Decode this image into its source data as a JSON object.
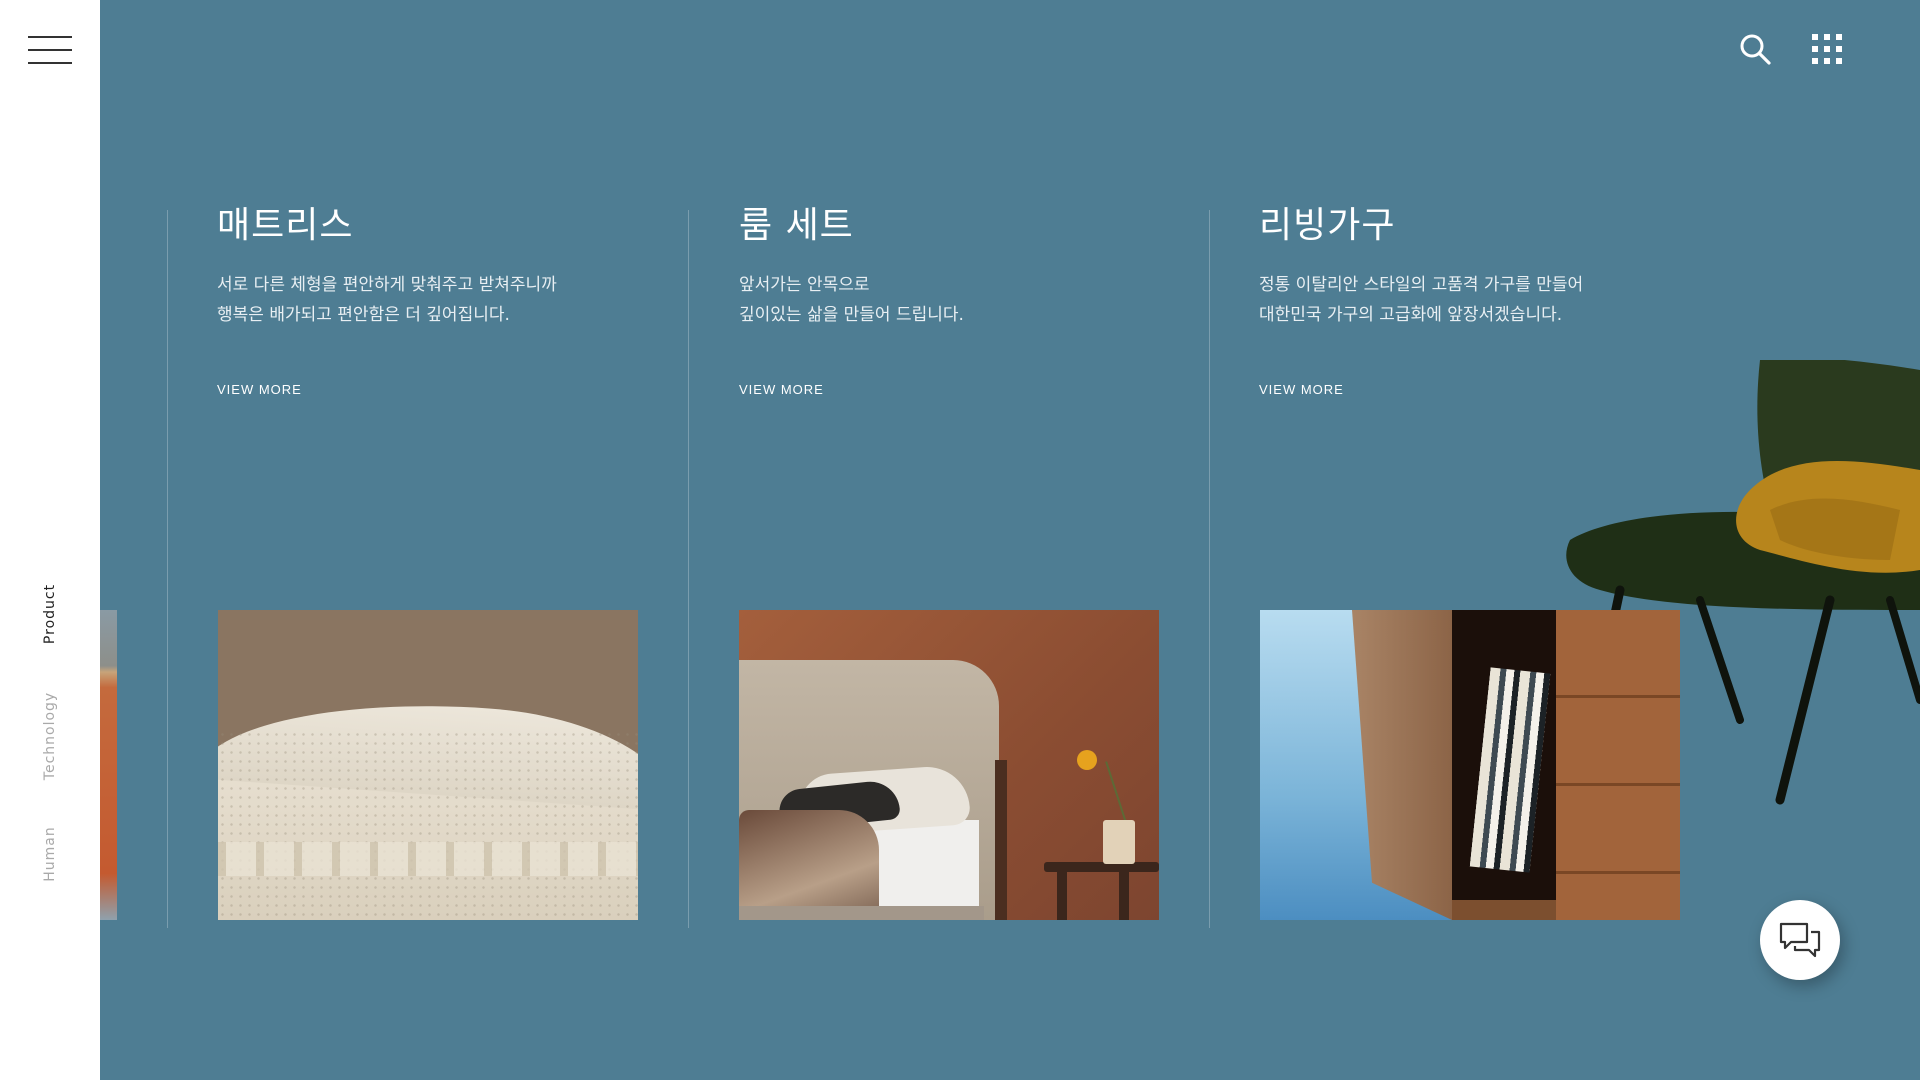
{
  "sidebar": {
    "menu_icon": "hamburger-menu-icon",
    "nav_items": [
      {
        "label": "Product",
        "active": true
      },
      {
        "label": "Technology",
        "active": false
      },
      {
        "label": "Human",
        "active": false
      }
    ]
  },
  "header": {
    "icons": [
      "search-icon",
      "grid-apps-icon"
    ]
  },
  "products": [
    {
      "title": "매트리스",
      "desc_line1": "서로 다른 체형을 편안하게 맞춰주고 받쳐주니까",
      "desc_line2": "행복은 배가되고 편안함은 더 깊어집니다.",
      "link": "VIEW MORE"
    },
    {
      "title": "룸 세트",
      "desc_line1": "앞서가는 안목으로",
      "desc_line2": "깊이있는 삶을 만들어 드립니다.",
      "link": "VIEW MORE"
    },
    {
      "title": "리빙가구",
      "desc_line1": "정통 이탈리안 스타일의 고품격 가구를 만들어",
      "desc_line2": "대한민국 가구의 고급화에 앞장서겠습니다.",
      "link": "VIEW MORE"
    }
  ],
  "chat": {
    "icon": "chat-bubbles-icon"
  },
  "colors": {
    "background": "#4e7d93",
    "sidebar": "#ffffff",
    "text": "#ffffff"
  }
}
